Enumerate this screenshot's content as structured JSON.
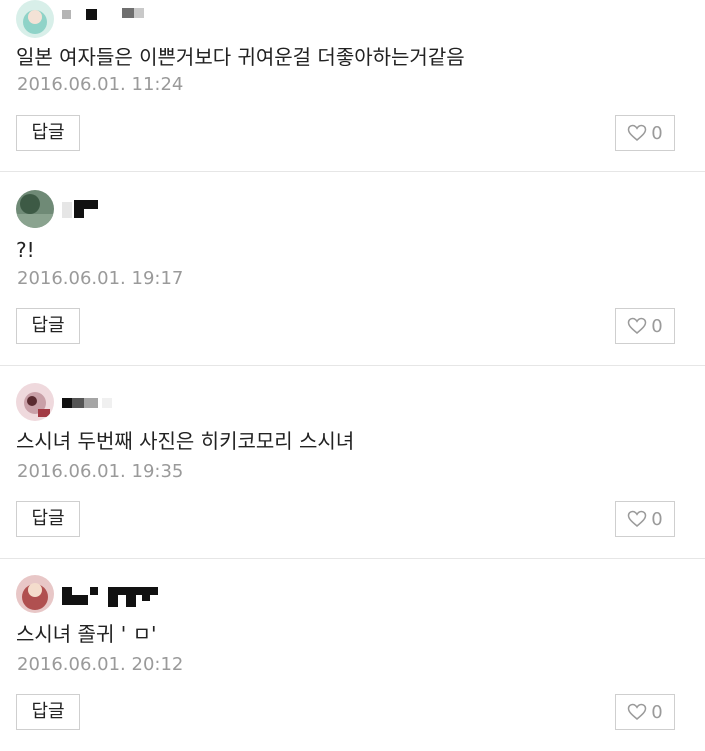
{
  "comments": [
    {
      "text": "일본 여자들은 이쁜거보다 귀여운걸 더좋아하는거같음",
      "date": "2016.06.01. 11:24",
      "reply_label": "답글",
      "like_count": "0",
      "avatar_color": "#8fd3c8"
    },
    {
      "text": "?!",
      "date": "2016.06.01. 19:17",
      "reply_label": "답글",
      "like_count": "0",
      "avatar_color": "#4a6a55"
    },
    {
      "text": "스시녀 두번째 사진은 히키코모리 스시녀",
      "date": "2016.06.01. 19:35",
      "reply_label": "답글",
      "like_count": "0",
      "avatar_color": "#c9a0a8"
    },
    {
      "text": "스시녀 졸귀 ' ㅁ'",
      "date": "2016.06.01. 20:12",
      "reply_label": "답글",
      "like_count": "0",
      "avatar_color": "#b05050"
    }
  ],
  "theme": {
    "text_color": "#222222",
    "meta_color": "#9a9a9a",
    "border_color": "#cfcfcf",
    "divider_color": "#e6e6e6"
  }
}
